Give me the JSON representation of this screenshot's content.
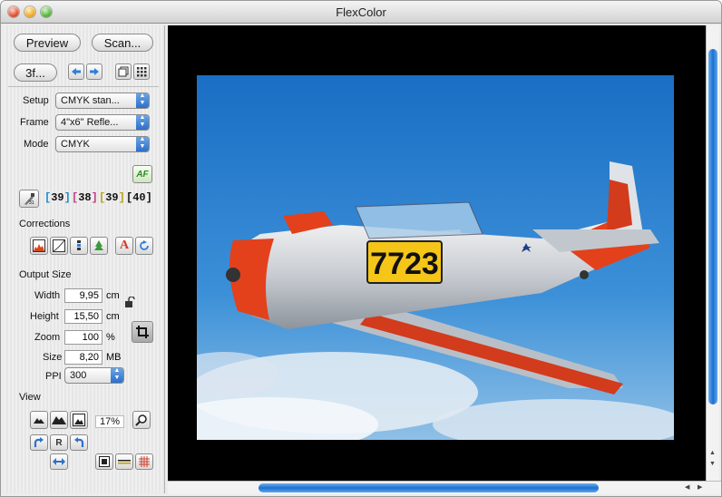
{
  "window": {
    "title": "FlexColor"
  },
  "toolbar": {
    "preview_label": "Preview",
    "scan_label": "Scan...",
    "film_label": "3f..."
  },
  "setup": {
    "label": "Setup",
    "value": "CMYK stan..."
  },
  "frame": {
    "label": "Frame",
    "value": "4\"x6\" Refle..."
  },
  "mode": {
    "label": "Mode",
    "value": "CMYK"
  },
  "af_label": "AF",
  "densities": [
    "39",
    "38",
    "39",
    "40"
  ],
  "densities_colors": [
    "#1a88c9",
    "#c23b85",
    "#b9a20a",
    "#111111"
  ],
  "corrections": {
    "title": "Corrections"
  },
  "output": {
    "title": "Output Size",
    "width_label": "Width",
    "width_value": "9,95",
    "width_unit": "cm",
    "height_label": "Height",
    "height_value": "15,50",
    "height_unit": "cm",
    "zoom_label": "Zoom",
    "zoom_value": "100",
    "zoom_unit": "%",
    "size_label": "Size",
    "size_value": "8,20",
    "size_unit": "MB",
    "ppi_label": "PPI",
    "ppi_value": "300"
  },
  "view": {
    "title": "View",
    "zoom_readout": "17%",
    "reset_label": "R"
  },
  "photo": {
    "plane_number": "7723"
  }
}
